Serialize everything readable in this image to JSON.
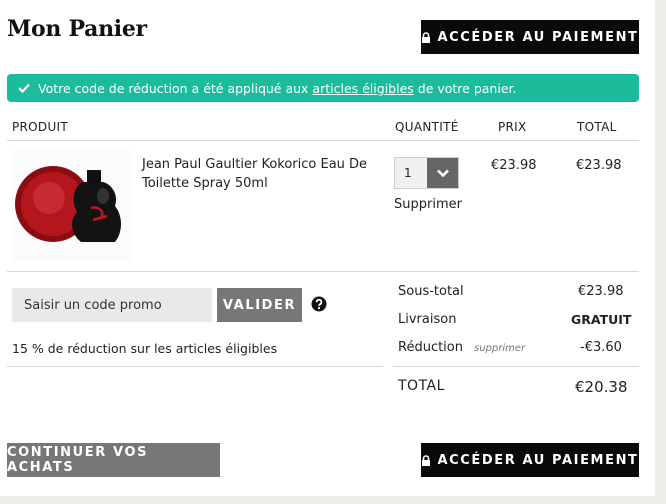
{
  "header": {
    "title": "Mon Panier",
    "checkout_label": "ACCÉDER AU PAIEMENT"
  },
  "notice": {
    "before": "Votre code de réduction a été appliqué aux ",
    "link": "articles éligibles",
    "after": " de votre panier.",
    "color": "#1abc9c"
  },
  "table": {
    "columns": [
      "PRODUIT",
      "QUANTITÉ",
      "PRIX",
      "TOTAL"
    ],
    "item": {
      "name": "Jean Paul Gaultier Kokorico Eau De Toilette Spray 50ml",
      "quantity": "1",
      "remove_label": "Supprimer",
      "price": "€23.98",
      "total": "€23.98",
      "image_icon": "perfume-bottle-icon"
    }
  },
  "promo": {
    "placeholder": "Saisir un code promo",
    "submit_label": "VALIDER",
    "note": "15 % de réduction sur les articles éligibles"
  },
  "summary": {
    "subtotal_label": "Sous-total",
    "subtotal_value": "€23.98",
    "shipping_label": "Livraison",
    "shipping_value": "GRATUIT",
    "discount_label": "Réduction",
    "discount_remove": "supprimer",
    "discount_value": "-€3.60",
    "total_label": "TOTAL",
    "total_value": "€20.38"
  },
  "footer": {
    "continue_label": "CONTINUER VOS ACHATS",
    "checkout_label": "ACCÉDER AU PAIEMENT"
  }
}
